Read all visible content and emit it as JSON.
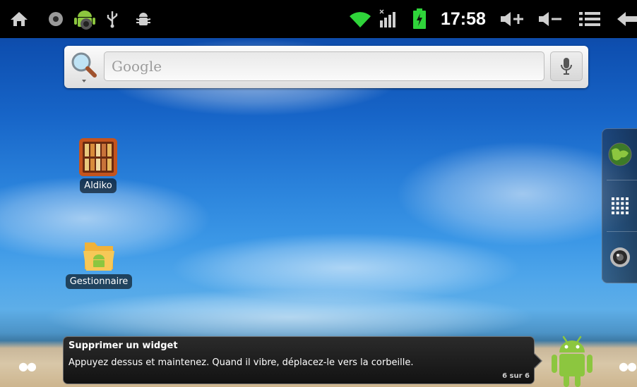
{
  "status_bar": {
    "time": "17:58",
    "left_icons": [
      "home-icon",
      "record-icon",
      "android-debug-icon",
      "usb-icon",
      "bug-icon"
    ],
    "right_icons": [
      "wifi-icon",
      "signal-icon",
      "battery-charging-icon",
      "volume-up-icon",
      "volume-down-icon",
      "menu-icon",
      "back-icon"
    ]
  },
  "search": {
    "placeholder": "Google"
  },
  "desktop": {
    "apps": [
      {
        "label": "Aldiko",
        "icon": "bookshelf-icon"
      },
      {
        "label": "Gestionnaire",
        "icon": "folder-android-icon"
      }
    ]
  },
  "dock": {
    "items": [
      "globe-icon",
      "app-grid-icon",
      "camera-icon"
    ]
  },
  "toast": {
    "title": "Supprimer un widget",
    "body": "Appuyez dessus et maintenez. Quand il vibre, déplacez-le vers la corbeille.",
    "count": "6 sur 6"
  },
  "colors": {
    "android_green": "#8cc63f",
    "sky_blue": "#1765c8",
    "status_bar_bg": "#000000"
  }
}
